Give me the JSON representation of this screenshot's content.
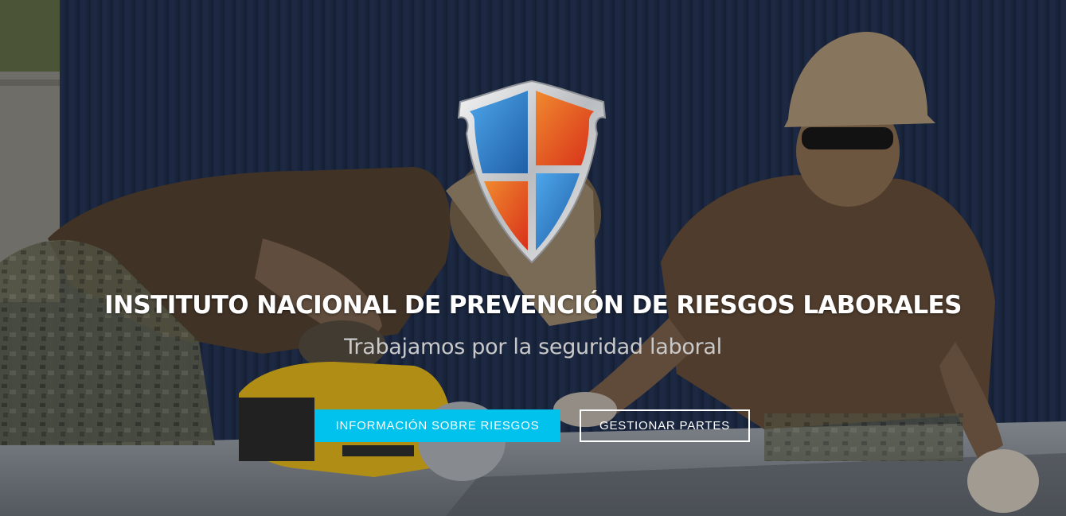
{
  "hero": {
    "title": "INSTITUTO NACIONAL DE PREVENCIÓN DE RIESGOS LABORALES",
    "subtitle": "Trabajamos por la seguridad laboral",
    "background_image": "construction-workers-roof-photo",
    "logo": "shield-logo"
  },
  "buttons": {
    "primary_label": "INFORMACIÓN SOBRE RIESGOS",
    "secondary_label": "GESTIONAR PARTES"
  },
  "colors": {
    "accent": "#00c2ec",
    "title": "#ffffff",
    "subtitle": "#c9c9c9",
    "shield_blue": "#2f7fc4",
    "shield_red": "#e0461f"
  }
}
